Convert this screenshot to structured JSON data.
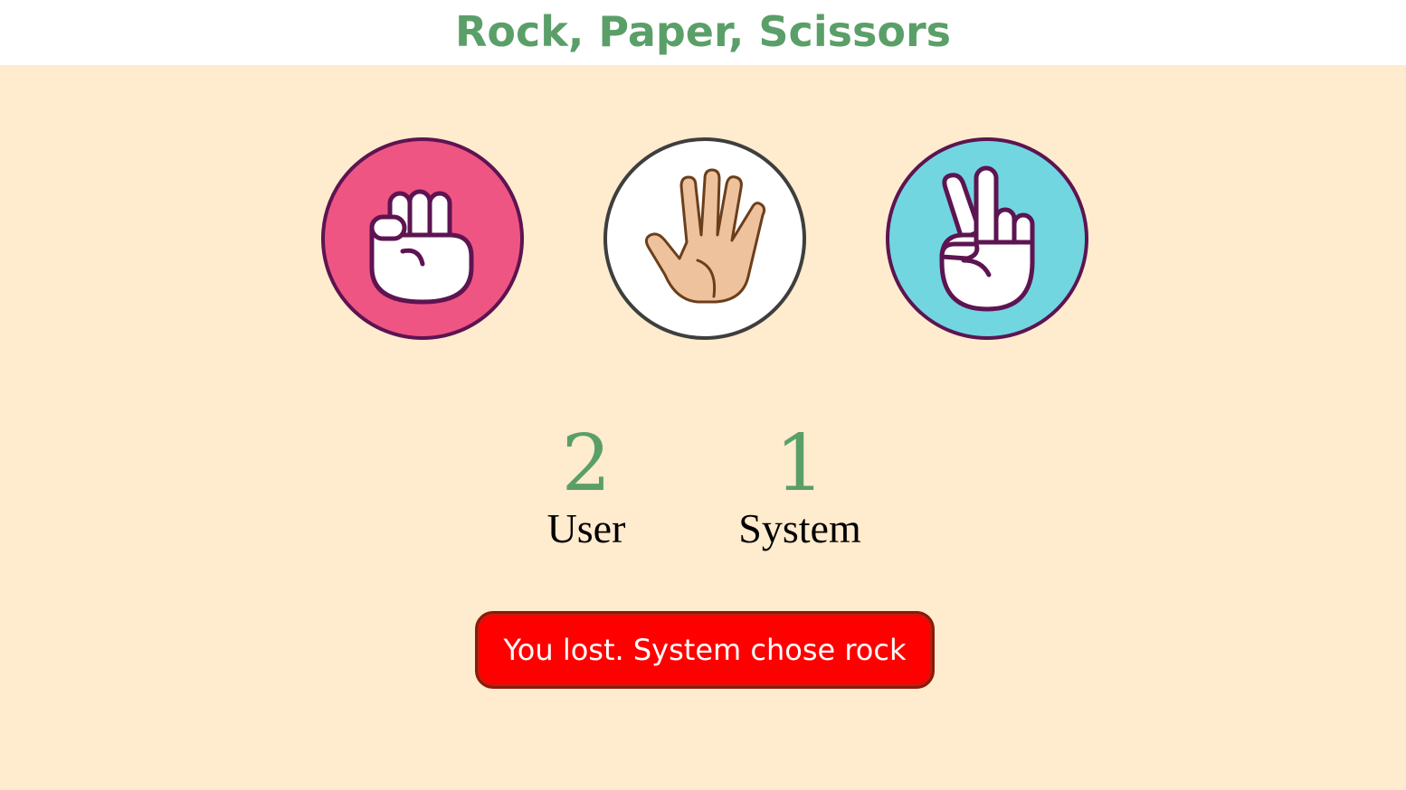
{
  "header": {
    "title": "Rock, Paper, Scissors"
  },
  "choices": [
    {
      "id": "rock",
      "icon": "fist-icon",
      "color": "#ef5583"
    },
    {
      "id": "paper",
      "icon": "open-hand-icon",
      "color": "#ffffff"
    },
    {
      "id": "scissors",
      "icon": "peace-hand-icon",
      "color": "#72d6e1"
    }
  ],
  "scores": {
    "user": {
      "value": "2",
      "label": "User"
    },
    "system": {
      "value": "1",
      "label": "System"
    }
  },
  "result": {
    "text": "You lost. System chose rock",
    "color": "#ff0000"
  }
}
